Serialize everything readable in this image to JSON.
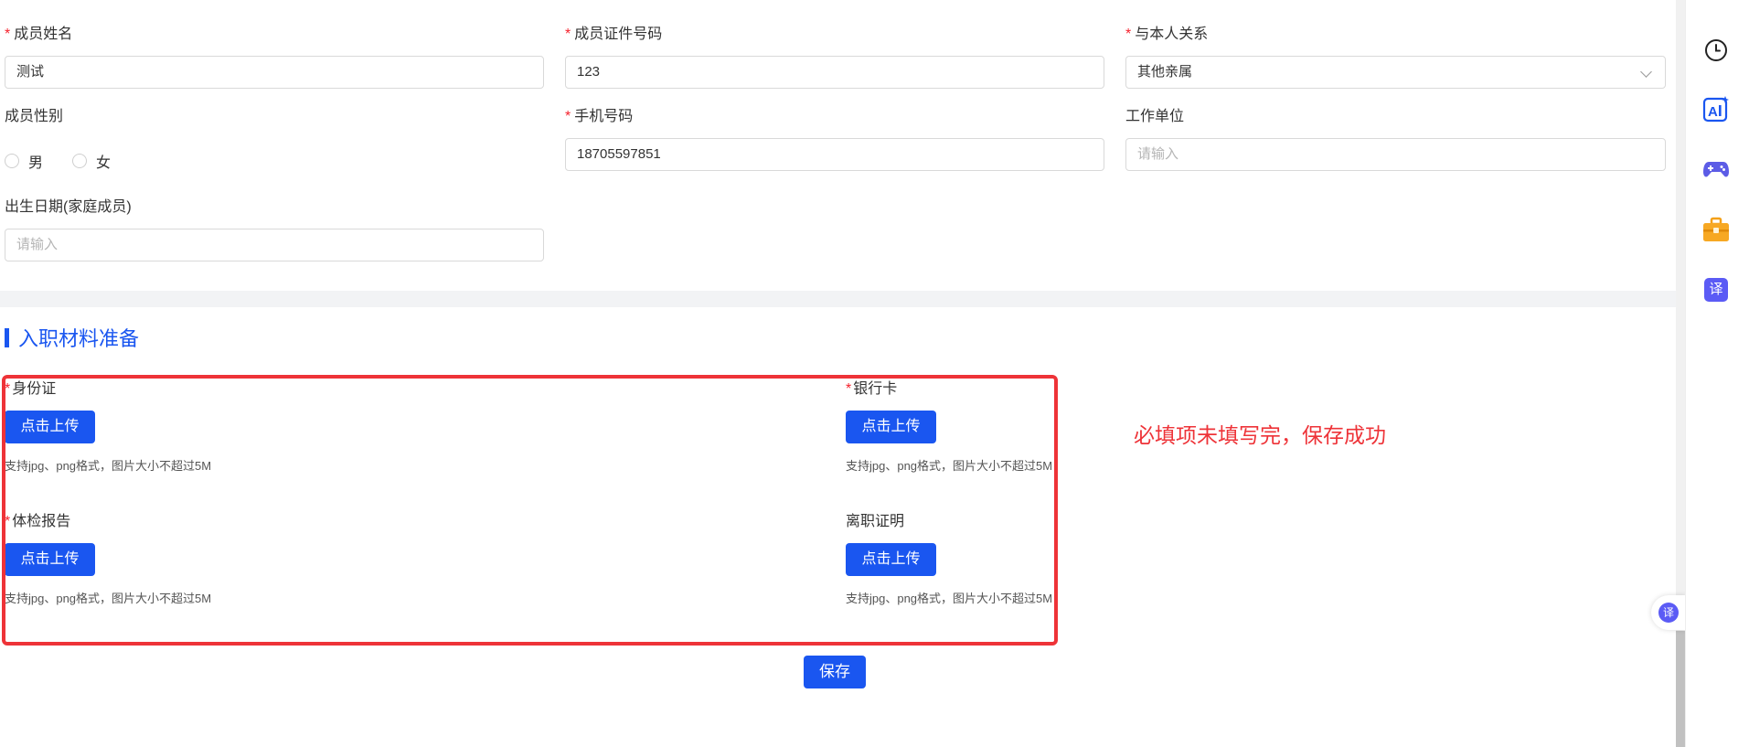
{
  "form": {
    "member_name": {
      "label": "成员姓名",
      "required": true,
      "value": "测试"
    },
    "member_id_no": {
      "label": "成员证件号码",
      "required": true,
      "value": "123"
    },
    "relationship": {
      "label": "与本人关系",
      "required": true,
      "value": "其他亲属"
    },
    "gender": {
      "label": "成员性别",
      "required": false,
      "options": [
        "男",
        "女"
      ]
    },
    "phone": {
      "label": "手机号码",
      "required": true,
      "value": "18705597851"
    },
    "employer": {
      "label": "工作单位",
      "required": false,
      "placeholder": "请输入"
    },
    "birth_date": {
      "label": "出生日期(家庭成员)",
      "required": false,
      "placeholder": "请输入"
    }
  },
  "section": {
    "title": "入职材料准备"
  },
  "uploads": [
    {
      "label": "身份证",
      "required": true,
      "button": "点击上传",
      "hint": "支持jpg、png格式，图片大小不超过5M"
    },
    {
      "label": "银行卡",
      "required": true,
      "button": "点击上传",
      "hint": "支持jpg、png格式，图片大小不超过5M"
    },
    {
      "label": "体检报告",
      "required": true,
      "button": "点击上传",
      "hint": "支持jpg、png格式，图片大小不超过5M"
    },
    {
      "label": "离职证明",
      "required": false,
      "button": "点击上传",
      "hint": "支持jpg、png格式，图片大小不超过5M"
    }
  ],
  "annotation": {
    "note": "必填项未填写完，保存成功"
  },
  "actions": {
    "save_label": "保存"
  },
  "sidebar": {
    "icons": [
      "clock-icon",
      "ai-icon",
      "gamepad-icon",
      "toolbox-icon",
      "translate-icon"
    ],
    "translate_glyph": "译",
    "ai_glyph": "AI"
  },
  "float_button": {
    "glyph": "译"
  },
  "colors": {
    "primary": "#1a56f0",
    "required": "#f5222d",
    "annotation": "#ee3338"
  }
}
